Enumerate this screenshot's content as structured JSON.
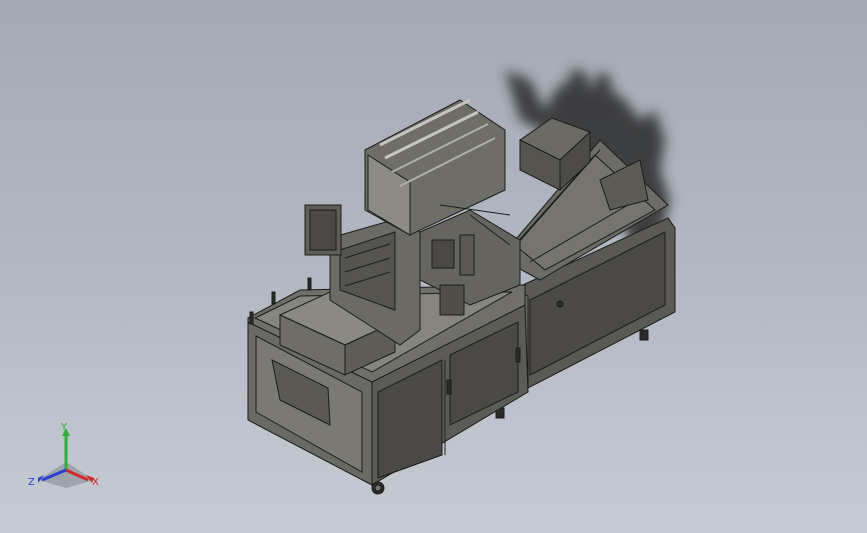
{
  "viewport": {
    "background_top": "#a4aab4",
    "background_bottom": "#c6cbd3",
    "model_color": "#5e5c56",
    "panel_color": "#4a4945",
    "edge_color": "#1c1c1a"
  },
  "triad": {
    "x_label": "X",
    "y_label": "Y",
    "z_label": "Z",
    "x_color": "#d22b2b",
    "y_color": "#2fae3a",
    "z_color": "#2b3fd6"
  }
}
